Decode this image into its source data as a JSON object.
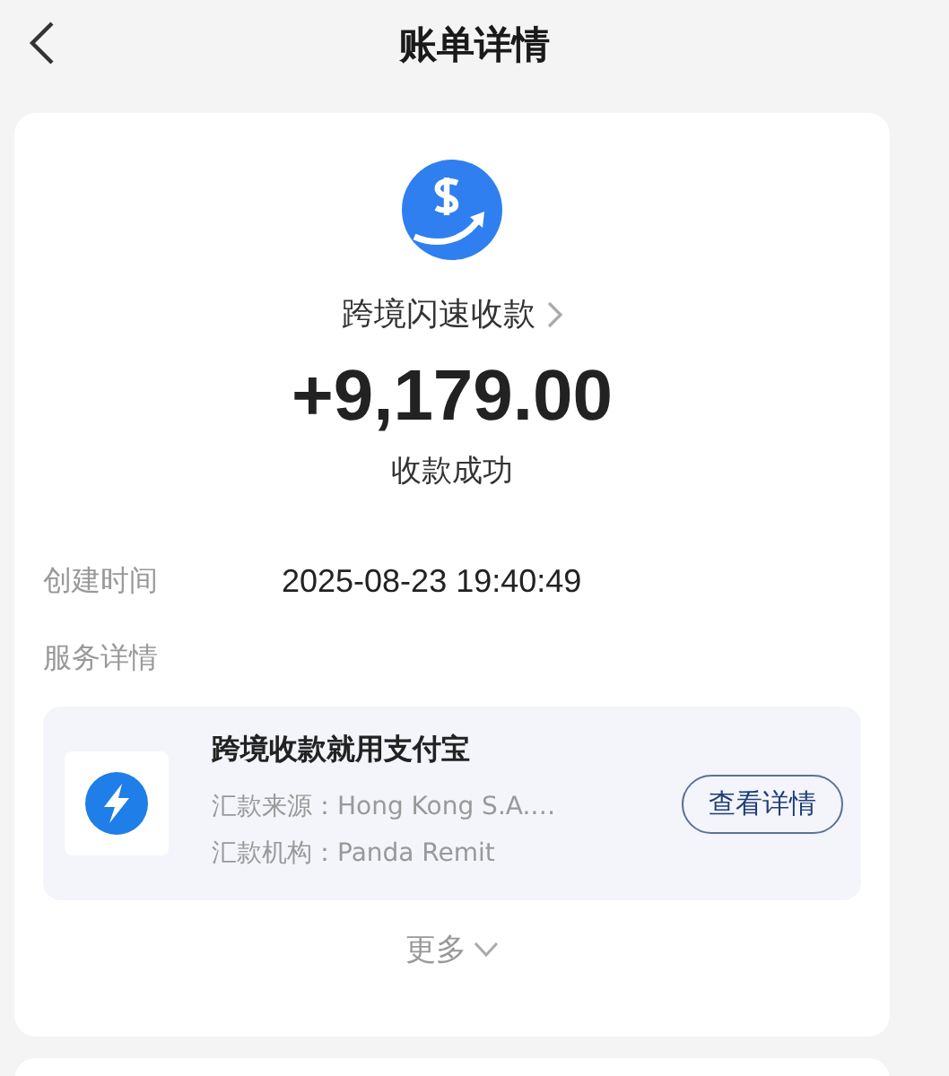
{
  "header": {
    "title": "账单详情"
  },
  "summary": {
    "name": "跨境闪速收款",
    "amount": "+9,179.00",
    "status": "收款成功"
  },
  "fields": [
    {
      "label": "创建时间",
      "value": "2025-08-23 19:40:49"
    }
  ],
  "service": {
    "heading": "服务详情",
    "title": "跨境收款就用支付宝",
    "lines": [
      "汇款来源：Hong Kong S.A.…",
      "汇款机构：Panda Remit"
    ],
    "button": "查看详情"
  },
  "more": "更多"
}
